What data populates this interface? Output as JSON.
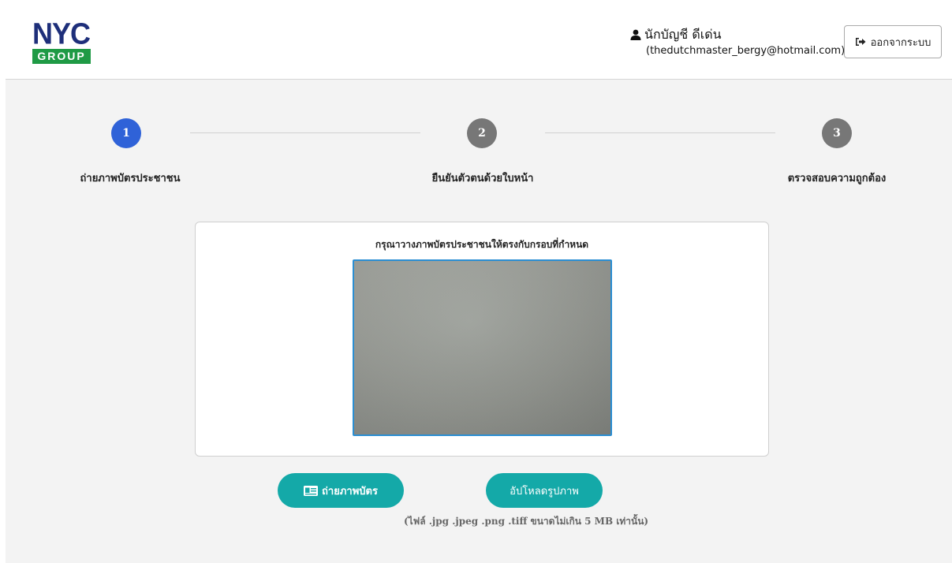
{
  "header": {
    "logo": {
      "line1": "NYC",
      "line2": "GROUP"
    },
    "user": {
      "icon": "user-icon",
      "name": "นักบัญชี ดีเด่น",
      "email": "(thedutchmaster_bergy@hotmail.com)"
    },
    "logout": {
      "icon": "sign-out-icon",
      "label": "ออกจากระบบ"
    }
  },
  "stepper": {
    "current": 1,
    "colors": {
      "active": "#2f62d8",
      "inactive": "#777777"
    },
    "steps": [
      {
        "number": "1",
        "label": "ถ่ายภาพบัตรประชาชน"
      },
      {
        "number": "2",
        "label": "ยืนยันตัวตนด้วยใบหน้า"
      },
      {
        "number": "3",
        "label": "ตรวจสอบความถูกต้อง"
      }
    ]
  },
  "capture": {
    "instruction": "กรุณาวางภาพบัตรประชาชนให้ตรงกับกรอบที่กำหนด",
    "frame_color": "#2b8ed2"
  },
  "actions": {
    "capture_icon": "id-card-icon",
    "capture_label": "ถ่ายภาพบัตร",
    "upload_label": "อัปโหลดรูปภาพ",
    "button_color": "#14a9a8",
    "file_note": "(ไฟล์ .jpg .jpeg .png .tiff ขนาดไม่เกิน 5 MB เท่านั้น)"
  }
}
